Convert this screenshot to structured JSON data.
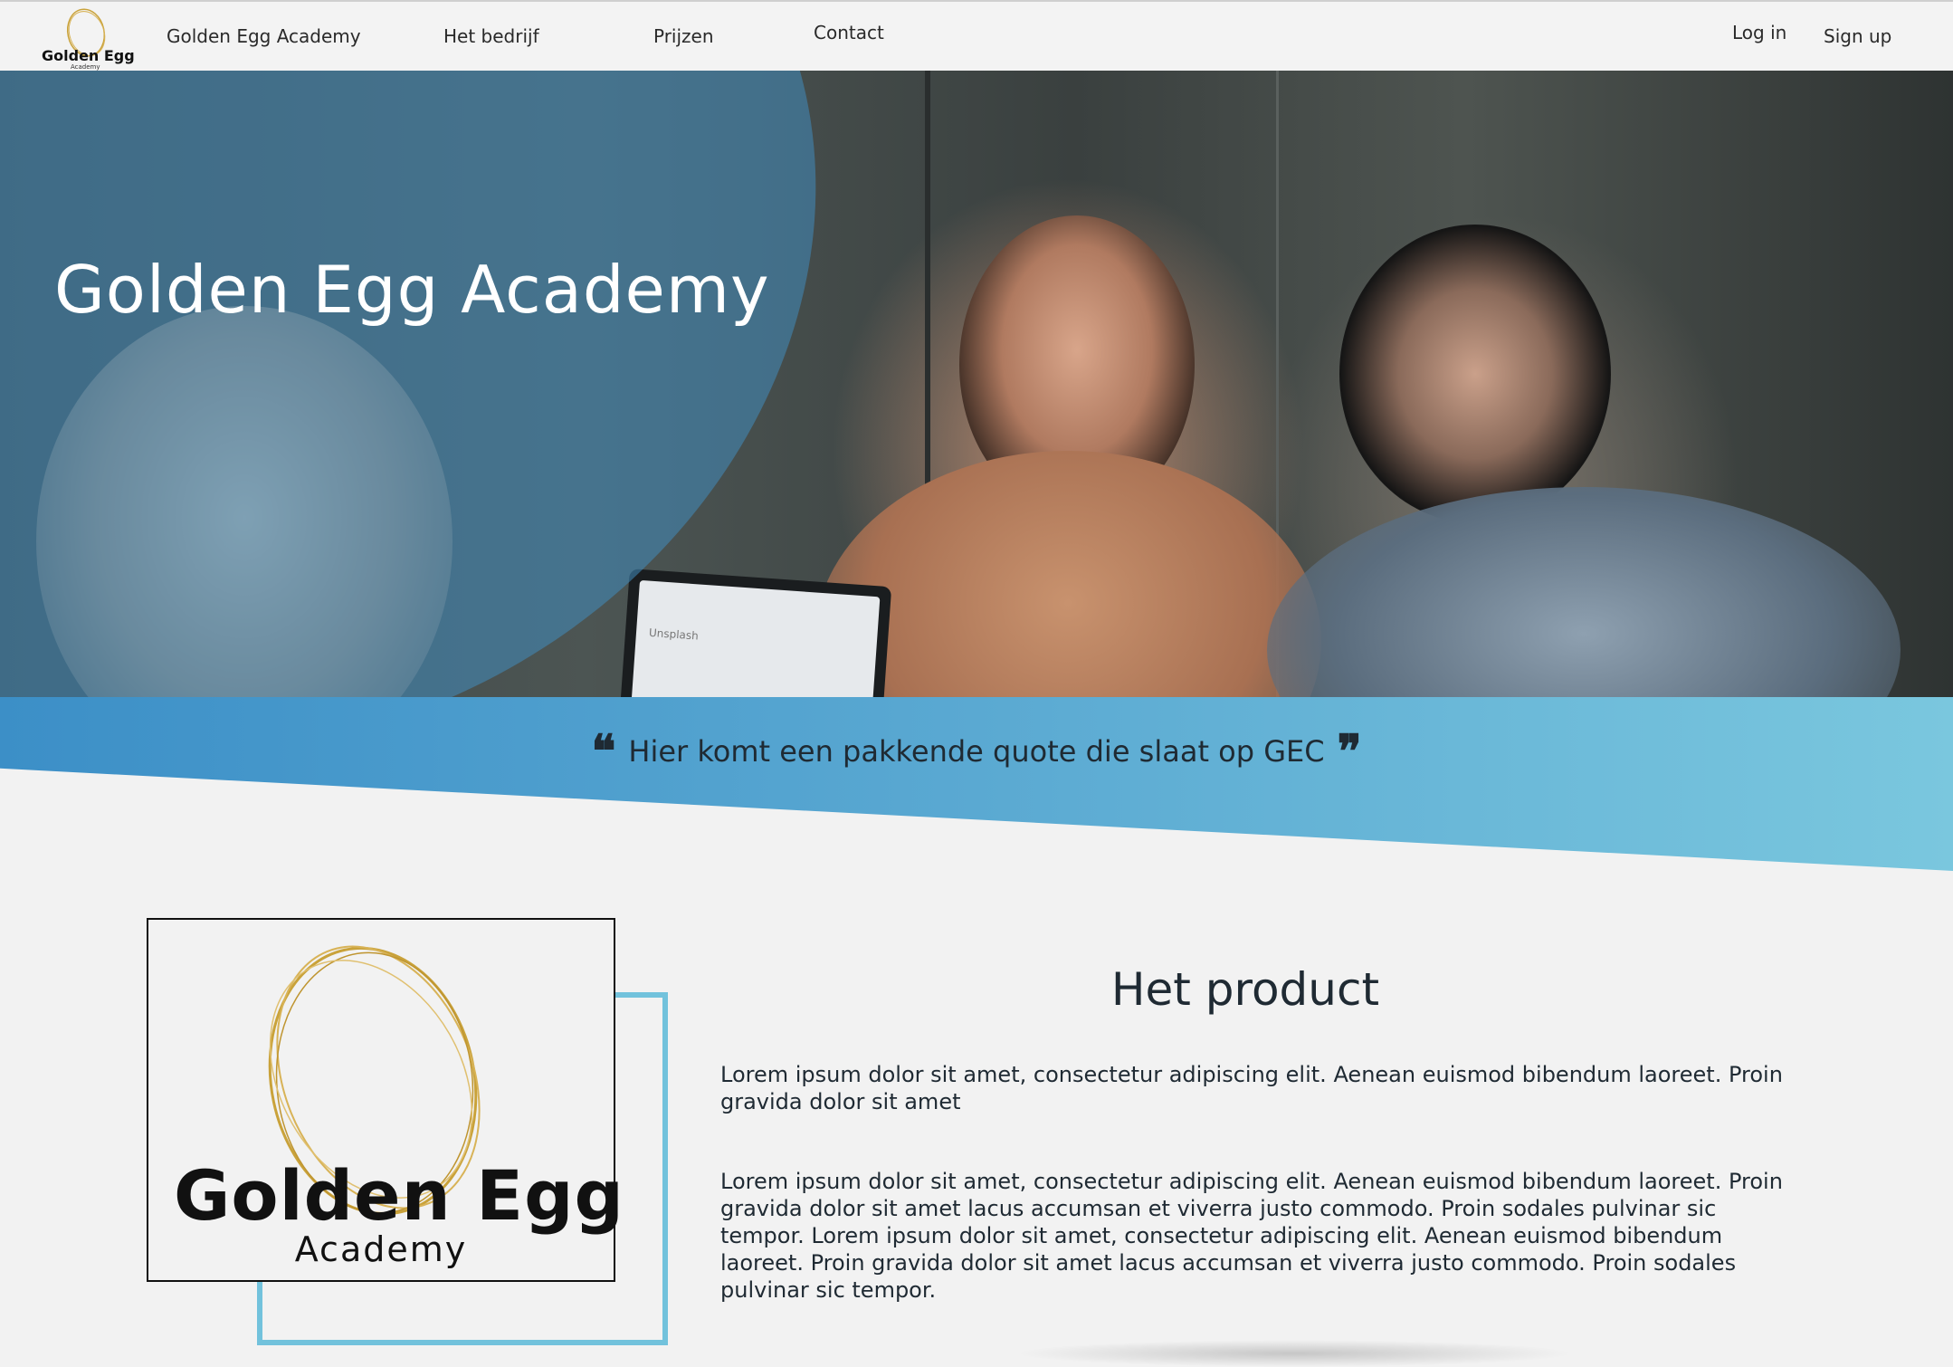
{
  "nav": {
    "logo_text": "Golden Egg",
    "logo_sub": "Academy",
    "links": [
      "Golden Egg Academy",
      "Het bedrijf",
      "Prijzen",
      "Contact"
    ],
    "login": "Log in",
    "signup": "Sign up"
  },
  "hero": {
    "title": "Golden Egg Academy",
    "laptop_text": "Unsplash"
  },
  "quote": {
    "text": "Hier komt een pakkende quote die slaat op GEC",
    "open_mark": "❝",
    "close_mark": "❞"
  },
  "product": {
    "logo_main": "Golden Egg",
    "logo_sub": "Academy",
    "title": "Het product",
    "paragraph_1": "Lorem ipsum dolor sit amet, consectetur adipiscing elit. Aenean euismod bibendum laoreet. Proin gravida dolor sit amet",
    "paragraph_2": "Lorem ipsum dolor sit amet, consectetur adipiscing elit. Aenean euismod bibendum laoreet. Proin gravida dolor sit amet lacus accumsan et viverra justo commodo. Proin sodales pulvinar sic tempor. Lorem ipsum dolor sit amet, consectetur adipiscing elit. Aenean euismod bibendum laoreet. Proin gravida dolor sit amet lacus accumsan et viverra justo commodo. Proin sodales pulvinar sic tempor."
  },
  "colors": {
    "accent_blue": "#3c8fc7",
    "light_blue": "#72c2dc",
    "gold": "#c9a23a"
  }
}
